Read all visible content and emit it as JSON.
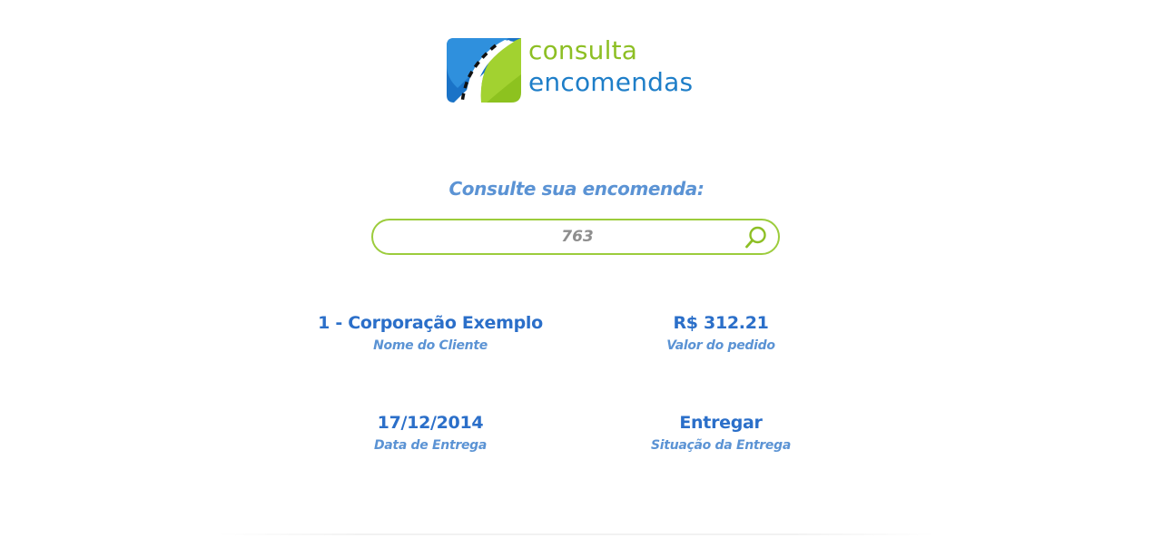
{
  "logo": {
    "word_top": "consulta",
    "word_bottom": "encomendas",
    "icon": "road-leaf-logo-icon",
    "colors": {
      "green": "#8dbf24",
      "blue": "#1e7ec8"
    }
  },
  "search": {
    "title": "Consulte sua encomenda:",
    "value": "763",
    "button_icon": "search-icon",
    "border_color": "#9ccc3c"
  },
  "results": [
    {
      "value": "1 - Corporação Exemplo",
      "label": "Nome do Cliente"
    },
    {
      "value": "R$ 312.21",
      "label": "Valor do pedido"
    },
    {
      "value": "17/12/2014",
      "label": "Data de Entrega"
    },
    {
      "value": "Entregar",
      "label": "Situação da Entrega"
    }
  ],
  "colors": {
    "value_text": "#2b6fc9",
    "label_text": "#5b93d4"
  }
}
